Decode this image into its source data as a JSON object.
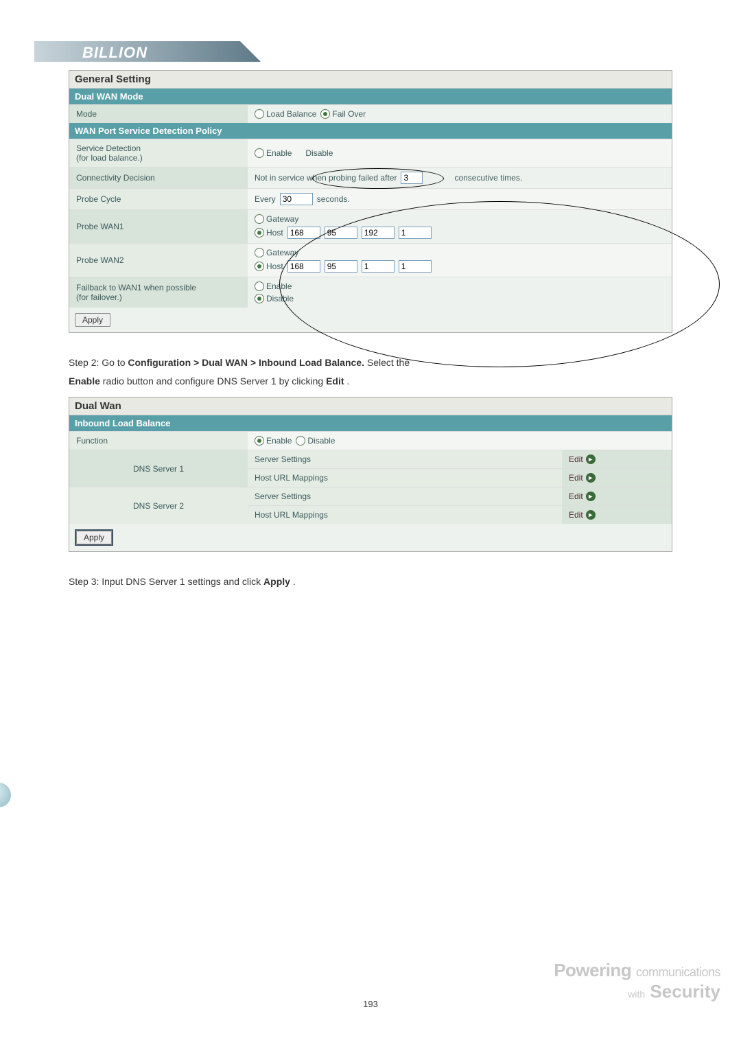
{
  "logo_text": "BILLION",
  "general": {
    "title": "General Setting",
    "sections": {
      "dual_wan_mode": "Dual WAN Mode",
      "wan_detect": "WAN Port Service Detection Policy"
    },
    "rows": {
      "mode_label": "Mode",
      "mode_opt_lb": "Load Balance",
      "mode_opt_fo": "Fail Over",
      "sd_label": "Service Detection\n(for load balance.)",
      "sd_enable": "Enable",
      "sd_disable": "Disable",
      "cd_label": "Connectivity Decision",
      "cd_pre": "Not in service when probing failed after",
      "cd_val": "3",
      "cd_post": "consecutive times.",
      "pc_label": "Probe Cycle",
      "pc_pre": "Every",
      "pc_val": "30",
      "pc_post": "seconds.",
      "pw1_label": "Probe WAN1",
      "pw2_label": "Probe WAN2",
      "gw": "Gateway",
      "host": "Host",
      "pw1_ip": [
        "168",
        "95",
        "192",
        "1"
      ],
      "pw2_ip": [
        "168",
        "95",
        "1",
        "1"
      ],
      "fb_label": "Failback to WAN1 when possible\n(for failover.)",
      "fb_enable": "Enable",
      "fb_disable": "Disable"
    },
    "apply": "Apply"
  },
  "step2_line1": "Step 2: Go to ",
  "step2_bold": "Configuration > Dual WAN > Inbound Load Balance.",
  "step2_line1b": " Select the ",
  "step2_bold2": "Enable",
  "step2_line2": " radio button and configure DNS Server 1 by clicking ",
  "step2_bold3": "Edit",
  "step2_tail": ".",
  "dualwan": {
    "title": "Dual Wan",
    "section": "Inbound Load Balance",
    "func_label": "Function",
    "func_enable": "Enable",
    "func_disable": "Disable",
    "dns1": "DNS Server 1",
    "dns2": "DNS Server 2",
    "ss": "Server Settings",
    "hum": "Host URL Mappings",
    "edit": "Edit",
    "apply": "Apply"
  },
  "step3": "Step 3: Input DNS Server 1 settings and click ",
  "step3_bold": "Apply",
  "step3_tail": ".",
  "page_number": "193",
  "powering": {
    "p1a": "Powering",
    "p1b": "communications",
    "p2a": "with",
    "p2b": "Security"
  }
}
